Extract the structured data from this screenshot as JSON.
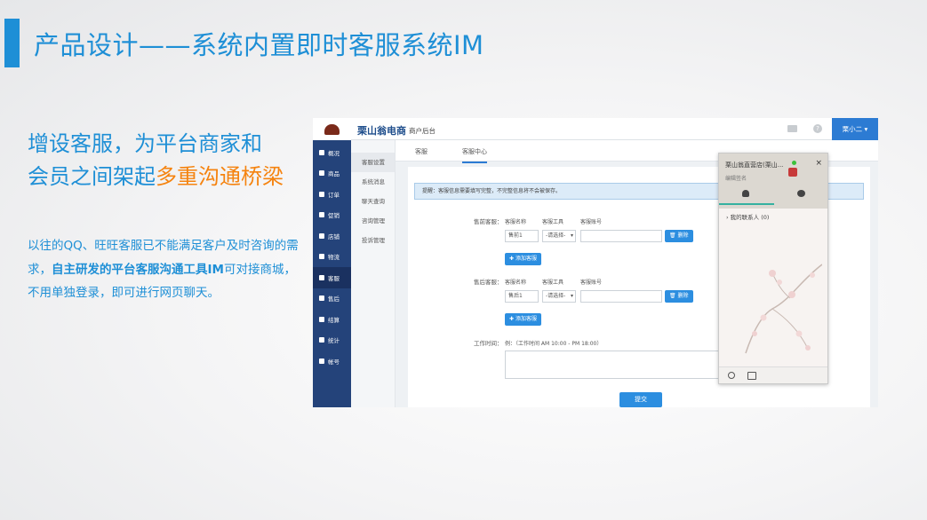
{
  "slide": {
    "title": "产品设计——系统内置即时客服系统IM",
    "headline_line1": "增设客服，为平台商家和",
    "headline_line2_a": "会员之间架起",
    "headline_line2_b": "多重沟通桥梁",
    "para_a": "以往的QQ、旺旺客服已不能满足客户及时咨询的需求，",
    "para_bold": "自主研发的平台客服沟通工具IM",
    "para_b": "可对接商城，不用单独登录，即可进行网页聊天。"
  },
  "app": {
    "brand": "栗山翁电商",
    "brand_sub": "商户后台",
    "help_glyph": "?",
    "user": "栗小二",
    "sidebar": [
      "概况",
      "商品",
      "订单",
      "促销",
      "店铺",
      "物流",
      "客服",
      "售后",
      "结算",
      "统计",
      "帐号"
    ],
    "sidebar_active": "客服",
    "subnav": [
      "客服设置",
      "系统消息",
      "聊天查询",
      "咨询管理",
      "投诉管理"
    ],
    "tabs": [
      "客服",
      "客服中心"
    ],
    "notice": "提醒：客服信息需要填写完整，不完整信息将不会被保存。",
    "presale_label": "售前客服：",
    "aftersale_label": "售后客服：",
    "col_name": "客服名称",
    "col_tool": "客服工具",
    "col_account": "客服账号",
    "presale_name": "售前1",
    "aftersale_name": "售后1",
    "select_placeholder": "-请选择-",
    "delete_btn": "删除",
    "add_btn": "添加客服",
    "worktime_label": "工作时间：",
    "worktime_hint": "例：（工作时间 AM 10:00 - PM 18:00）",
    "submit_btn": "提交"
  },
  "chat": {
    "shop_name": "栗山翁直营店(栗山...",
    "sign": "编辑签名",
    "close": "×",
    "contacts": "我的联系人",
    "contacts_count": "(0)"
  },
  "colors": {
    "accent": "#1e8fd6",
    "highlight": "#f5830f",
    "sidebar": "#24437a",
    "button": "#2c8ee0"
  }
}
